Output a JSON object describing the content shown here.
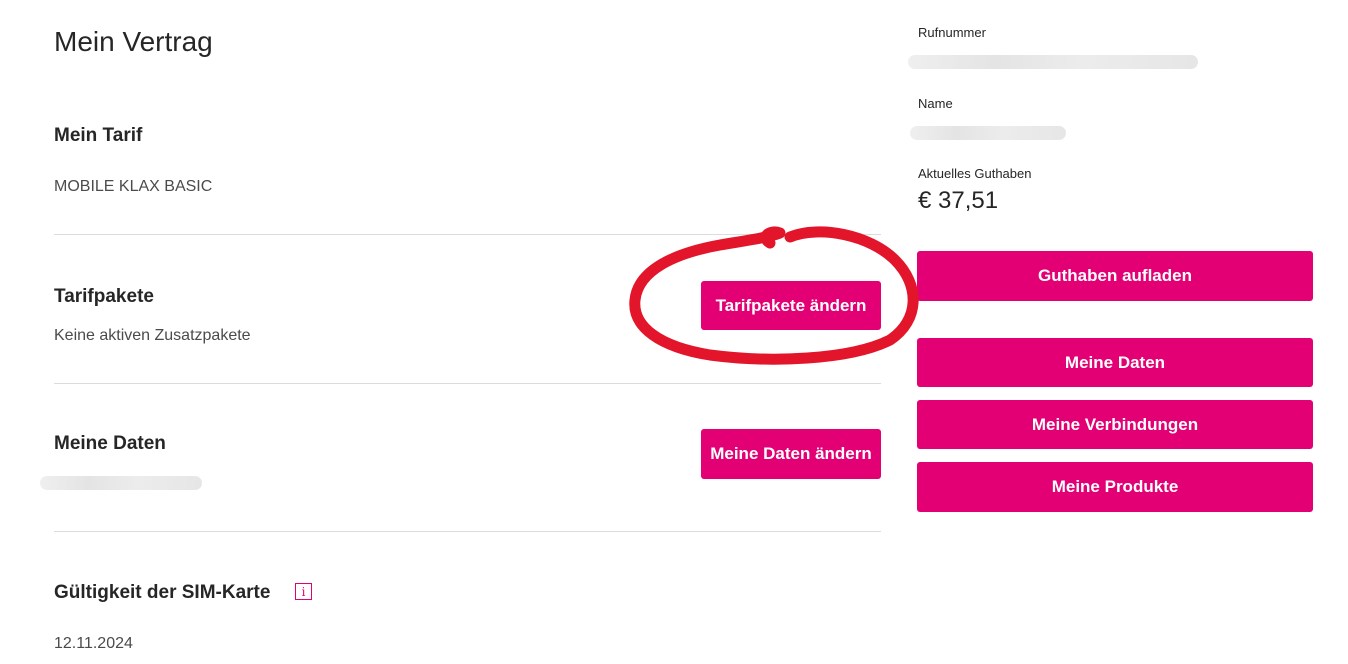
{
  "page": {
    "title": "Mein Vertrag"
  },
  "tarif": {
    "heading": "Mein Tarif",
    "value": "MOBILE KLAX BASIC"
  },
  "tarifpakete": {
    "heading": "Tarifpakete",
    "value": "Keine aktiven Zusatzpakete",
    "button_label": "Tarifpakete ändern"
  },
  "meine_daten": {
    "heading": "Meine Daten",
    "button_label": "Meine Daten ändern"
  },
  "sim": {
    "heading": "Gültigkeit der SIM-Karte",
    "value": "12.11.2024",
    "info_icon": "i"
  },
  "sidebar": {
    "rufnummer_label": "Rufnummer",
    "name_label": "Name",
    "guthaben_label": "Aktuelles Guthaben",
    "guthaben_value": "€ 37,51",
    "buttons": [
      {
        "label": "Guthaben aufladen"
      },
      {
        "label": "Meine Daten"
      },
      {
        "label": "Meine Verbindungen"
      },
      {
        "label": "Meine Produkte"
      }
    ]
  },
  "colors": {
    "brand": "#e20074",
    "annotation": "#e3152b"
  },
  "icons": {
    "info": "info-icon"
  }
}
